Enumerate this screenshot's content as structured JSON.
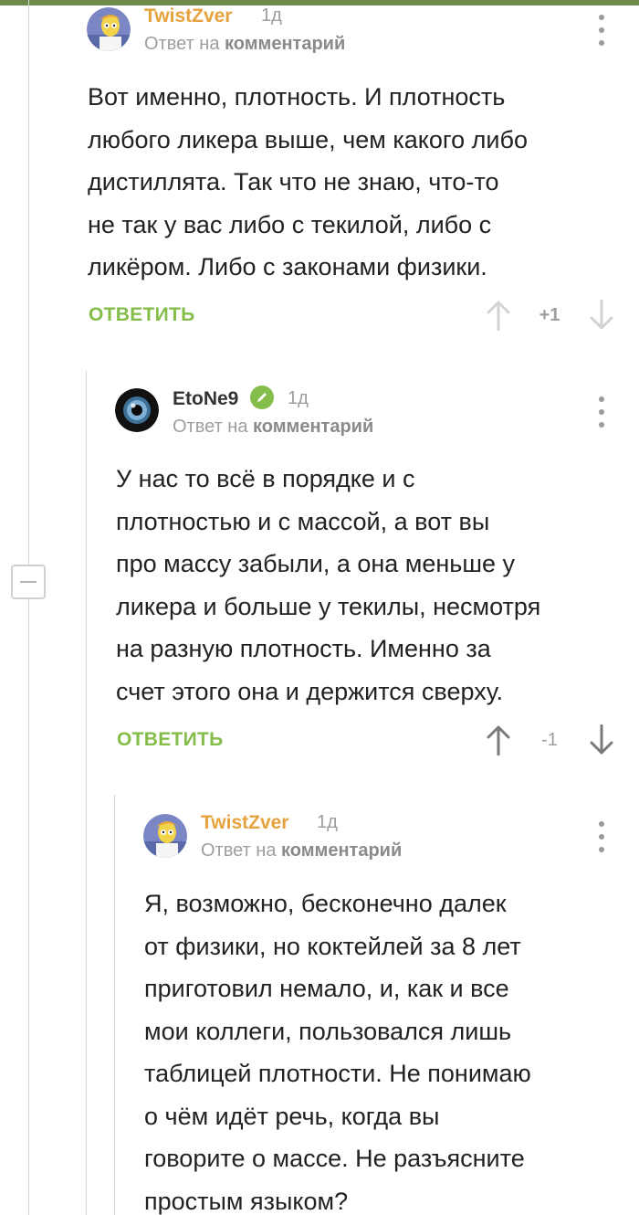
{
  "comments": [
    {
      "author": "TwistZver",
      "age": "1д",
      "reply_prefix": "Ответ на",
      "reply_link": "комментарий",
      "lines": [
        "Вот именно, плотность. И плотность",
        "любого ликера выше, чем какого либо",
        "дистиллята. Так что не знаю, что-то",
        "не так у вас либо с текилой, либо с",
        "ликёром. Либо с законами физики."
      ],
      "reply_label": "ОТВЕТИТЬ",
      "rating": "+1"
    },
    {
      "author": "EtoNe9",
      "age": "1д",
      "reply_prefix": "Ответ на",
      "reply_link": "комментарий",
      "lines": [
        "У нас то всё в порядке и с",
        "плотностью и с массой, а вот вы",
        "про массу забыли, а она меньше у",
        "ликера и больше у текилы, несмотря",
        "на разную плотность. Именно за",
        "счет этого она и держится сверху."
      ],
      "reply_label": "ОТВЕТИТЬ",
      "rating": "-1"
    },
    {
      "author": "TwistZver",
      "age": "1д",
      "reply_prefix": "Ответ на",
      "reply_link": "комментарий",
      "lines": [
        "Я, возможно, бесконечно далек",
        "от физики, но коктейлей за 8 лет",
        "приготовил немало, и, как и все",
        "мои коллеги, пользовался лишь",
        "таблицей плотности. Не понимаю",
        "о чём идёт речь, когда вы",
        "говорите о массе. Не разъясните",
        "простым языком?"
      ]
    }
  ],
  "colors": {
    "accent_green": "#85bd4a",
    "author_gold": "#e6a23c",
    "meta_gray": "#9e9e9e"
  }
}
